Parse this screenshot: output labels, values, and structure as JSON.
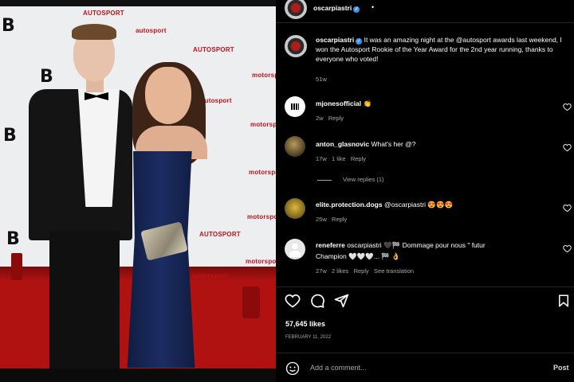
{
  "photo": {
    "wall_logos": [
      "AUTOSPORT",
      "autosport",
      "AUTOSPORT",
      "autosport",
      "motorsport",
      "motorsport",
      "motorsport",
      "motorsport",
      "AUTOSPORT",
      "motorsport",
      "motorsport"
    ],
    "big_b": "B"
  },
  "header": {
    "username": "oscarpiastri",
    "more": "•"
  },
  "caption": {
    "username": "oscarpiastri",
    "text": "It was an amazing night at the @autosport awards last weekend, I won the Autosport Rookie of the Year Award for the 2nd year running, thanks to everyone who voted!",
    "time": "51w"
  },
  "comments": [
    {
      "username": "mjonesofficial",
      "text": "👏",
      "time": "2w",
      "likes": "",
      "reply": "Reply"
    },
    {
      "username": "anton_glasnovic",
      "text": "What's her @?",
      "time": "17w",
      "likes": "1 like",
      "reply": "Reply",
      "view_replies": "View replies (1)"
    },
    {
      "username": "elite.protection.dogs",
      "text": "@oscarpiastri 😍😍😍",
      "time": "25w",
      "likes": "",
      "reply": "Reply"
    },
    {
      "username": "reneferre",
      "text": "oscarpiastri 🖤🏁 Dommage pour nous \" futur",
      "text2": "Champion 🤍🤍🤍... 🏁 👌",
      "time": "27w",
      "likes": "2 likes",
      "reply": "Reply",
      "translate": "See translation"
    }
  ],
  "actions": {
    "likes": "57,645 likes",
    "date": "FEBRUARY 11, 2022"
  },
  "comment_box": {
    "placeholder": "Add a comment...",
    "post": "Post"
  },
  "colors": {
    "background": "#000000",
    "verified": "#3897f0",
    "muted_text": "#a8a8a8",
    "carpet": "#b01212"
  }
}
